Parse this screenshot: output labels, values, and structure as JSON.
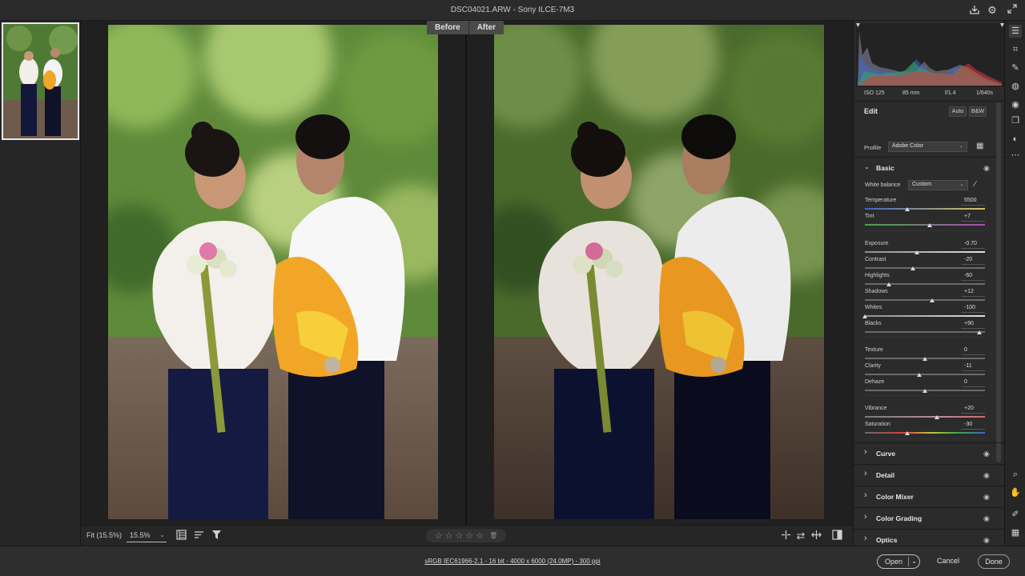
{
  "window": {
    "title": "DSC04021.ARW  -  Sony ILCE-7M3"
  },
  "compare": {
    "before_label": "Before",
    "after_label": "After"
  },
  "canvas_bar": {
    "fit_label": "Fit (15.5%)",
    "zoom_value": "15.5%",
    "stars": [
      "☆",
      "☆",
      "☆",
      "☆",
      "☆"
    ],
    "trash_glyph": "🗑"
  },
  "footer": {
    "info": "sRGB IEC61966-2.1 - 16 bit - 4000 x 6000 (24.0MP) - 300 ppi",
    "open_label": "Open",
    "cancel_label": "Cancel",
    "done_label": "Done"
  },
  "histogram": {
    "iso": "ISO 125",
    "focal": "85 mm",
    "aperture": "f/1.4",
    "shutter": "1/640s"
  },
  "edit": {
    "title": "Edit",
    "auto_label": "Auto",
    "bw_label": "B&W",
    "profile_label": "Profile",
    "profile_value": "Adobe Color"
  },
  "basic": {
    "title": "Basic",
    "wb_label": "White balance",
    "wb_value": "Custom",
    "sliders": [
      {
        "label": "Temperature",
        "value": "5500",
        "pos": 0.35
      },
      {
        "label": "Tint",
        "value": "+7",
        "pos": 0.54
      },
      {
        "label": "Exposure",
        "value": "-0.70",
        "pos": 0.43
      },
      {
        "label": "Contrast",
        "value": "-20",
        "pos": 0.4
      },
      {
        "label": "Highlights",
        "value": "-60",
        "pos": 0.2
      },
      {
        "label": "Shadows",
        "value": "+12",
        "pos": 0.56
      },
      {
        "label": "Whites",
        "value": "-100",
        "pos": 0.0
      },
      {
        "label": "Blacks",
        "value": "+90",
        "pos": 0.95
      },
      {
        "label": "Texture",
        "value": "0",
        "pos": 0.5
      },
      {
        "label": "Clarity",
        "value": "-11",
        "pos": 0.45
      },
      {
        "label": "Dehaze",
        "value": "0",
        "pos": 0.5
      },
      {
        "label": "Vibrance",
        "value": "+20",
        "pos": 0.6
      },
      {
        "label": "Saturation",
        "value": "-30",
        "pos": 0.35
      }
    ]
  },
  "sections": [
    {
      "name": "Curve"
    },
    {
      "name": "Detail"
    },
    {
      "name": "Color Mixer"
    },
    {
      "name": "Color Grading"
    },
    {
      "name": "Optics"
    }
  ],
  "colors": {
    "accent_bg": "#2b2b2b",
    "foliage": "#5f8a3a",
    "sweater": "#f0a12a"
  }
}
